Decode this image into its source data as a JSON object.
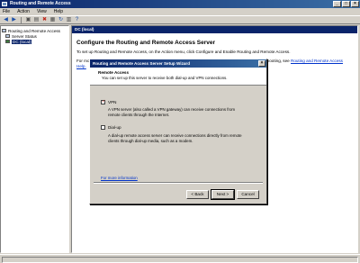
{
  "window": {
    "title": "Routing and Remote Access"
  },
  "menu": [
    "File",
    "Action",
    "View",
    "Help"
  ],
  "toolbar": {
    "icons": [
      "back-arrow-icon",
      "forward-arrow-icon",
      "up-folder-icon",
      "show-tree-icon",
      "delete-x-icon",
      "properties-icon",
      "refresh-icon",
      "export-icon",
      "help-icon"
    ]
  },
  "tree": {
    "root": "Routing and Remote Access",
    "items": [
      "Server Status",
      "DC (local)"
    ]
  },
  "rightpane": {
    "header": "DC (local)",
    "title": "Configure the Routing and Remote Access Server",
    "para1": "To set up Routing and Remote Access, on the Action menu, click Configure and Enable Routing and Remote Access.",
    "para2_a": "For more information about setting up a server and Remote Access, deployment scenarios, and troubleshooting, see",
    "para2_link": "Routing and Remote Access Help."
  },
  "wizard": {
    "title": "Routing and Remote Access Server Setup Wizard",
    "header_title": "Remote Access",
    "header_sub": "You can set up this server to receive both dial-up and VPN connections.",
    "vpn_label": "VPN",
    "vpn_checked": true,
    "vpn_desc": "A VPN server (also called a VPN gateway) can receive connections from remote clients through the Internet.",
    "dialup_label": "Dial-up",
    "dialup_checked": false,
    "dialup_desc": "A dial-up remote access server can receive connections directly from remote clients through dial-up media, such as a modem.",
    "more_info": "For more information",
    "back": "< Back",
    "next": "Next >",
    "cancel": "Cancel"
  }
}
